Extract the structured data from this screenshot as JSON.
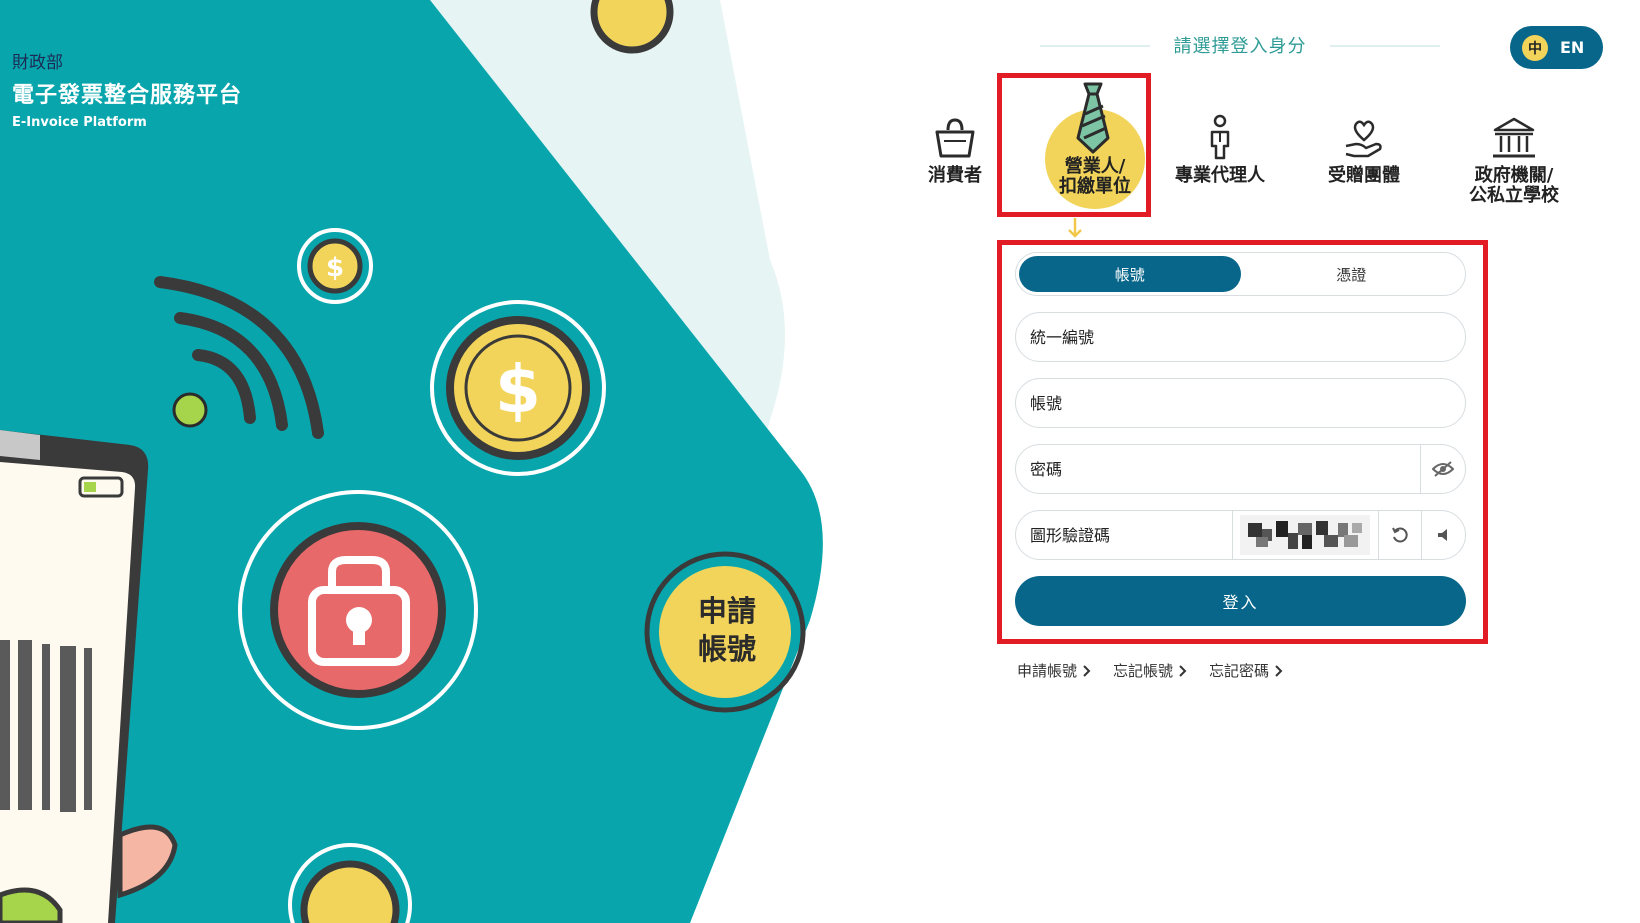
{
  "brand": {
    "ministry": "財政部",
    "title": "電子發票整合服務平台",
    "subtitle": "E-Invoice Platform"
  },
  "hero": {
    "apply_line1": "申請",
    "apply_line2": "帳號"
  },
  "header": {
    "choose_identity": "請選擇登入身分",
    "lang_zh": "中",
    "lang_en": "EN"
  },
  "roles": [
    {
      "label": "消費者",
      "icon": "shopping-bag-icon"
    },
    {
      "label1": "營業人/",
      "label2": "扣繳單位",
      "icon": "necktie-icon",
      "selected": true
    },
    {
      "label": "專業代理人",
      "icon": "person-icon"
    },
    {
      "label": "受贈團體",
      "icon": "heart-hand-icon"
    },
    {
      "label1": "政府機關/",
      "label2": "公私立學校",
      "icon": "government-building-icon"
    }
  ],
  "login_form": {
    "tabs": [
      {
        "label": "帳號",
        "active": true
      },
      {
        "label": "憑證",
        "active": false
      }
    ],
    "business_id_placeholder": "統一編號",
    "account_placeholder": "帳號",
    "password_placeholder": "密碼",
    "captcha_placeholder": "圖形驗證碼",
    "login_label": "登入"
  },
  "links": [
    "申請帳號",
    "忘記帳號",
    "忘記密碼"
  ],
  "colors": {
    "primary": "#07668a",
    "teal": "#08a6ac",
    "yellow": "#f2d45a",
    "highlight": "#e21c24",
    "red_coin": "#e8696a"
  }
}
